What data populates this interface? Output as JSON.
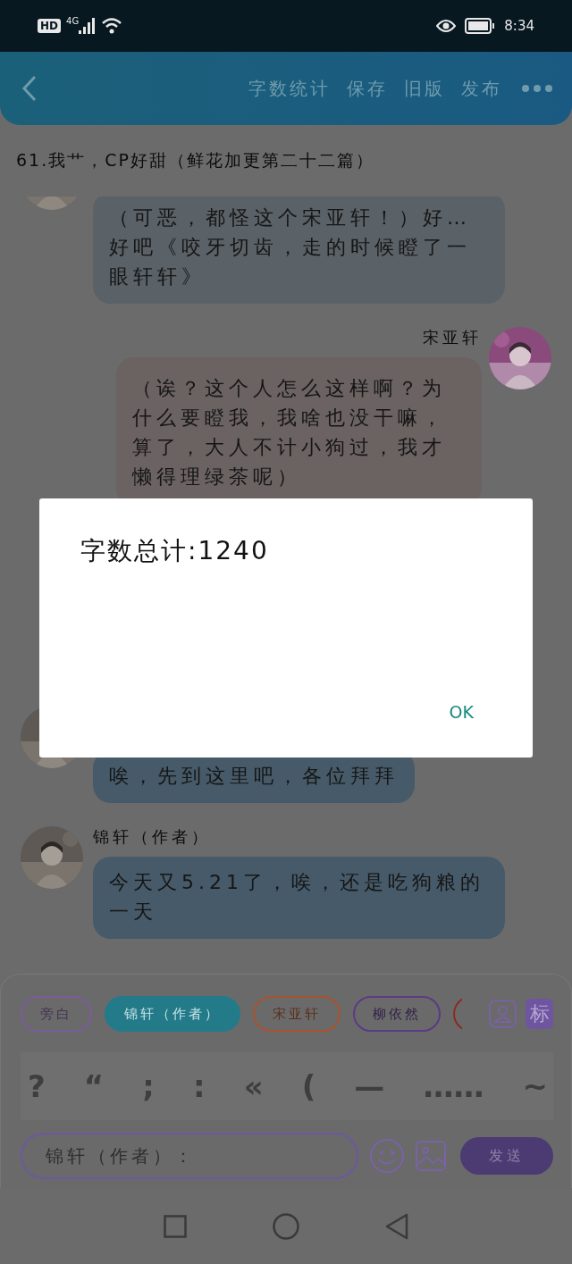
{
  "status_bar": {
    "hd": "HD",
    "network": "4G",
    "time": "8:34"
  },
  "toolbar": {
    "actions": [
      "字数统计",
      "保存",
      "旧版",
      "发布"
    ]
  },
  "chapter_title": "61.我艹，CP好甜（鲜花加更第二十二篇）",
  "messages": [
    {
      "kind": "received",
      "text": "（可恶，都怪这个宋亚轩！）好…好吧《咬牙切齿，走的时候瞪了一眼轩轩》",
      "color": "#5a6167"
    },
    {
      "kind": "sent",
      "name": "宋亚轩",
      "text": "（诶？这个人怎么这样啊？为什么要瞪我，我啥也没干嘛，算了，大人不计小狗过，我才懒得理绿茶呢）",
      "color": "#6b6262"
    },
    {
      "kind": "received",
      "text": "唉，先到这里吧，各位拜拜",
      "color": "#465a69"
    },
    {
      "kind": "received",
      "name": "锦轩（作者）",
      "text": "今天又5.21了，唉，还是吃狗粮的一天",
      "color": "#465a69"
    }
  ],
  "roles": [
    {
      "label": "旁白",
      "selected": false,
      "color": "#7a5c9c"
    },
    {
      "label": "锦轩（作者）",
      "selected": true,
      "color": "#237b8a"
    },
    {
      "label": "宋亚轩",
      "selected": false,
      "color": "#a8532e"
    },
    {
      "label": "柳依然",
      "selected": false,
      "color": "#5a3b84"
    }
  ],
  "mark_button": "标",
  "punctuation": [
    "?",
    "“",
    ";",
    ":",
    "«",
    "(",
    "—",
    "……",
    "~"
  ],
  "input": {
    "value": "锦轩（作者）："
  },
  "send_button": "发送",
  "dialog": {
    "message": "字数总计:1240",
    "button": "OK"
  }
}
